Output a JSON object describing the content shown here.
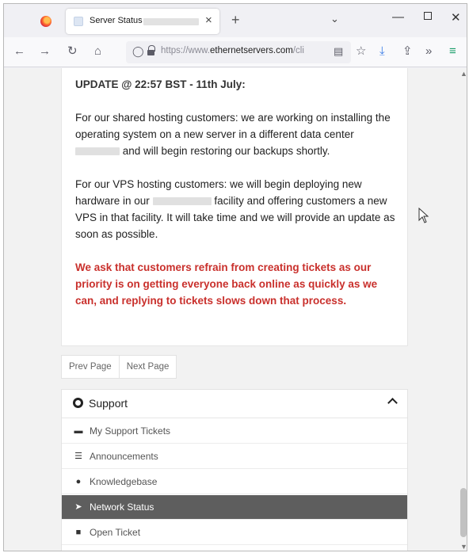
{
  "browser": {
    "tab": {
      "title": "Server Status"
    },
    "url": {
      "prefix": "https://www.",
      "domain": "ethernetservers.com",
      "suffix": "/cli"
    },
    "new_tab_glyph": "+",
    "tab_close_glyph": "×"
  },
  "article": {
    "heading": "UPDATE @ 22:57 BST - 11th July:",
    "p1_a": "For our shared hosting customers: we are working on installing the operating system on a new server in a different data center",
    "p1_b": "and will begin restoring our backups shortly.",
    "p2_a": "For our VPS hosting customers: we will begin deploying new hardware in our",
    "p2_b": "facility and offering customers a new VPS in that facility. It will take time and we will provide an update as soon as possible.",
    "warning": "We ask that customers refrain from creating tickets as our priority is on getting everyone back online as quickly as we can, and replying to tickets slows down that process."
  },
  "pager": {
    "prev": "Prev Page",
    "next": "Next Page"
  },
  "support": {
    "title": "Support",
    "items": [
      {
        "label": "My Support Tickets",
        "icon": "ticket-icon",
        "active": false
      },
      {
        "label": "Announcements",
        "icon": "list-icon",
        "active": false
      },
      {
        "label": "Knowledgebase",
        "icon": "info-icon",
        "active": false
      },
      {
        "label": "Network Status",
        "icon": "rocket-icon",
        "active": true
      },
      {
        "label": "Open Ticket",
        "icon": "comments-icon",
        "active": false
      }
    ]
  },
  "colors": {
    "warning": "#c9302c",
    "active_item": "#5e5e5e"
  }
}
